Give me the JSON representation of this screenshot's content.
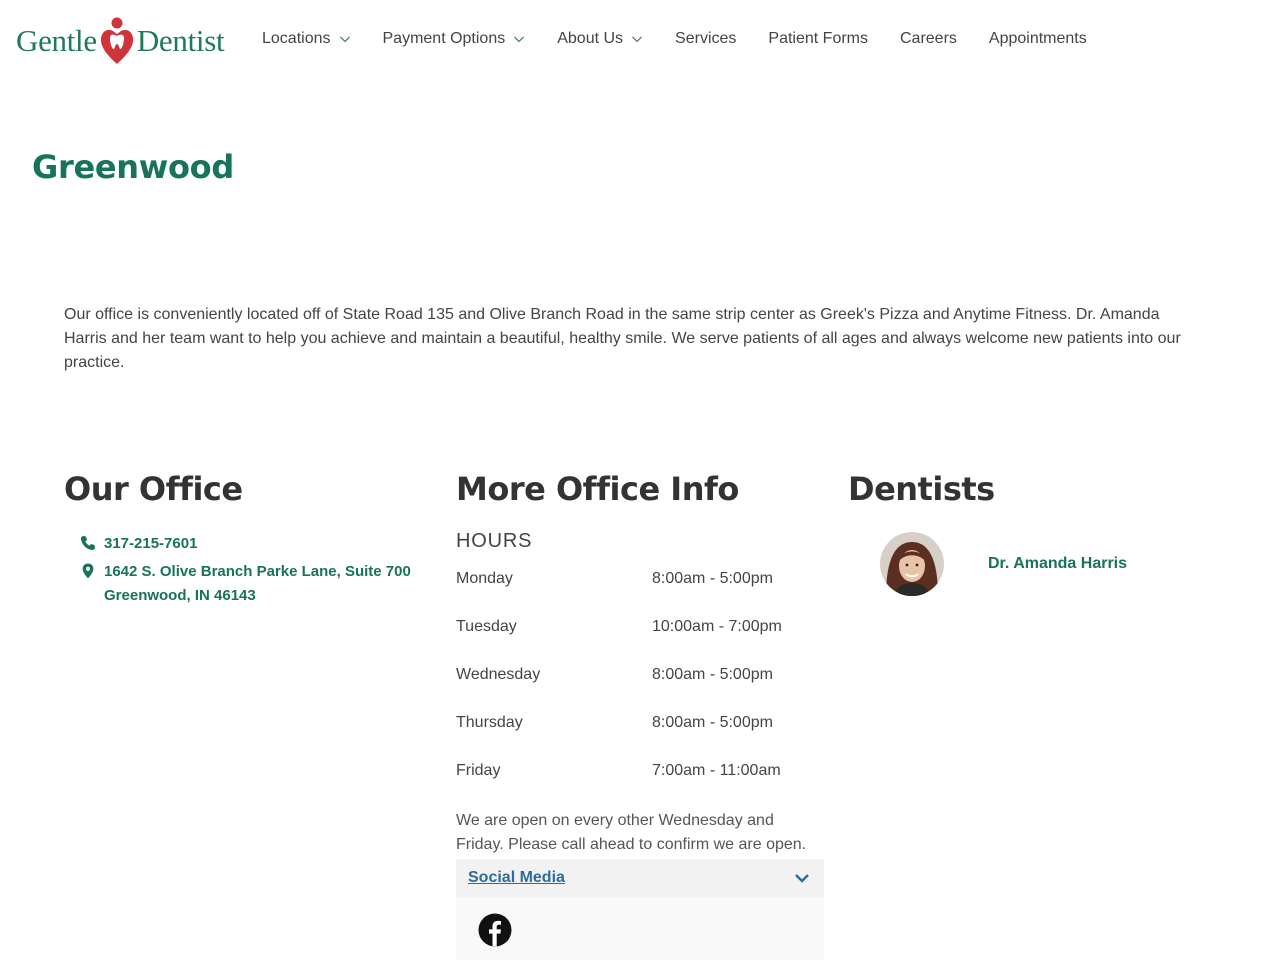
{
  "brand": {
    "left": "Gentle",
    "right": "Dentist",
    "green": "#1e7a5f",
    "red": "#d0343b"
  },
  "nav": [
    {
      "label": "Locations",
      "dropdown": true
    },
    {
      "label": "Payment Options",
      "dropdown": true
    },
    {
      "label": "About Us",
      "dropdown": true
    },
    {
      "label": "Services",
      "dropdown": false
    },
    {
      "label": "Patient Forms",
      "dropdown": false
    },
    {
      "label": "Careers",
      "dropdown": false
    },
    {
      "label": "Appointments",
      "dropdown": false
    }
  ],
  "page": {
    "title": "Greenwood",
    "intro": "Our office is conveniently located off of State Road 135 and Olive Branch Road in the same strip center as Greek's Pizza and Anytime Fitness. Dr. Amanda Harris and her team want to help you achieve and maintain a beautiful, healthy smile. We serve patients of all ages and always welcome new patients into our practice."
  },
  "office": {
    "heading": "Our Office",
    "phone": "317-215-7601",
    "address_line1": "1642 S. Olive Branch Parke Lane, Suite 700",
    "address_line2": "Greenwood, IN 46143"
  },
  "info": {
    "heading": "More Office Info",
    "hours_label": "HOURS",
    "hours": [
      {
        "day": "Monday",
        "time": "8:00am - 5:00pm"
      },
      {
        "day": "Tuesday",
        "time": "10:00am - 7:00pm"
      },
      {
        "day": "Wednesday",
        "time": "8:00am - 5:00pm"
      },
      {
        "day": "Thursday",
        "time": "8:00am - 5:00pm"
      },
      {
        "day": "Friday",
        "time": "7:00am - 11:00am"
      }
    ],
    "note": "We are open on every other Wednesday and Friday. Please call ahead to confirm we are open.",
    "social_label": "Social Media",
    "social_icons": [
      "facebook-icon"
    ]
  },
  "dentists": {
    "heading": "Dentists",
    "items": [
      {
        "name": "Dr. Amanda Harris"
      }
    ]
  }
}
